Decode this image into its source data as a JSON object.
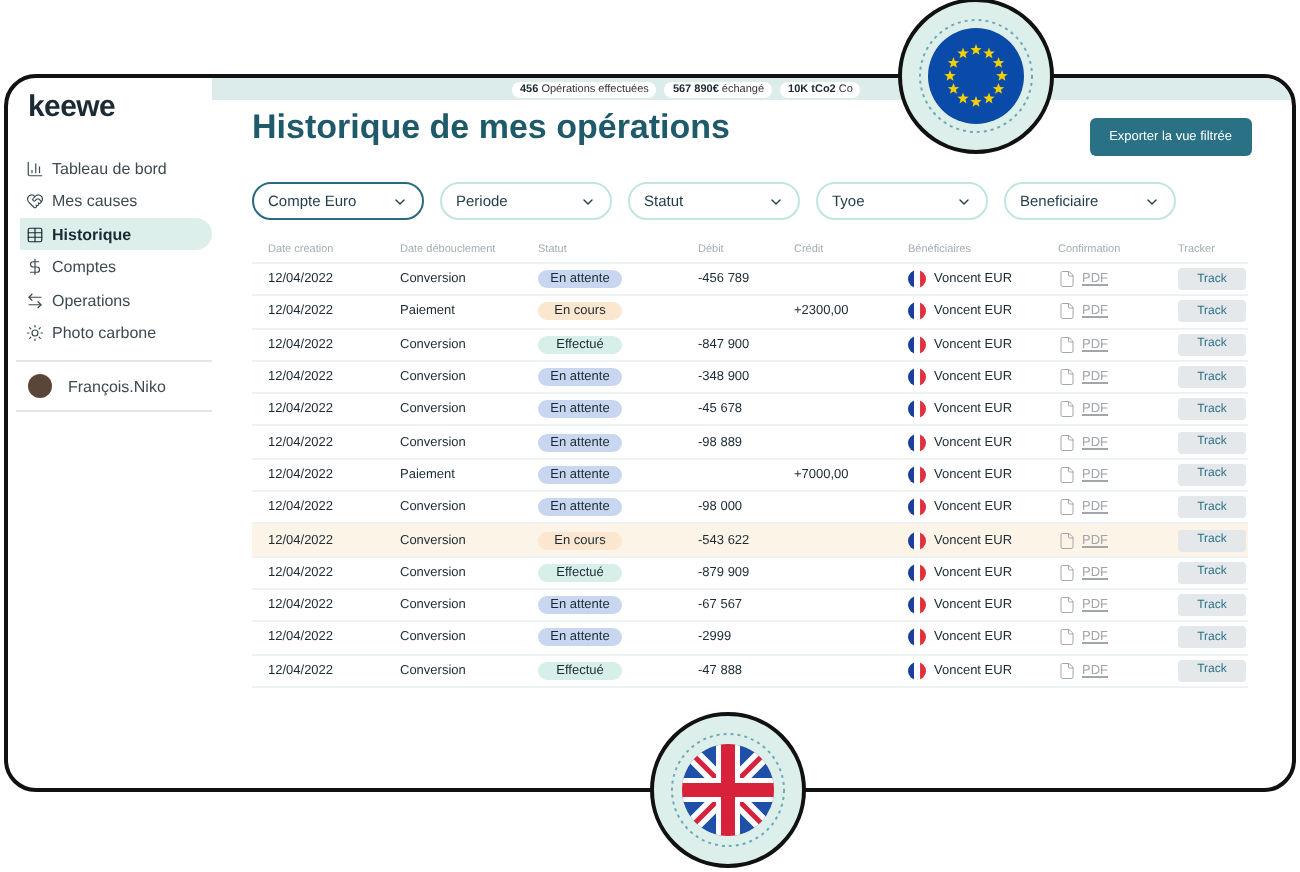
{
  "logo": "keewe",
  "sidebar": {
    "items": [
      {
        "label": "Tableau de bord",
        "selected": false
      },
      {
        "label": "Mes causes",
        "selected": false
      },
      {
        "label": "Historique",
        "selected": true
      },
      {
        "label": "Comptes",
        "selected": false
      },
      {
        "label": "Operations",
        "selected": false
      },
      {
        "label": "Photo carbone",
        "selected": false
      }
    ],
    "user": "François.Niko"
  },
  "stats": [
    {
      "value": "456",
      "label": "Opérations effectuées"
    },
    {
      "value": "567 890€",
      "label": "échangé"
    },
    {
      "value": "10K tCo2",
      "label": "Co"
    }
  ],
  "title": "Historique de mes opérations",
  "export_button": "Exporter la vue filtrée",
  "filters": [
    {
      "label": "Compte Euro",
      "active": true
    },
    {
      "label": "Periode",
      "active": false
    },
    {
      "label": "Statut",
      "active": false
    },
    {
      "label": "Tyoe",
      "active": false
    },
    {
      "label": "Beneficiaire",
      "active": false
    }
  ],
  "table": {
    "columns": [
      "Date creation",
      "Date débouclement",
      "Statut",
      "Débit",
      "Crédit",
      "Bénéficiaires",
      "Confirmation",
      "Tracker"
    ],
    "rows": [
      {
        "date": "12/04/2022",
        "type": "Conversion",
        "status": {
          "label": "En attente",
          "kind": "pending"
        },
        "debit": "-456 789",
        "credit": "",
        "beneficiary": "Voncent EUR",
        "confirmation": "PDF",
        "tracker": "Track",
        "selected": false
      },
      {
        "date": "12/04/2022",
        "type": "Paiement",
        "status": {
          "label": "En cours",
          "kind": "progress"
        },
        "debit": "",
        "credit": "+2300,00",
        "beneficiary": "Voncent EUR",
        "confirmation": "PDF",
        "tracker": "Track",
        "selected": false
      },
      {
        "date": "12/04/2022",
        "type": "Conversion",
        "status": {
          "label": "Effectué",
          "kind": "done"
        },
        "debit": "-847 900",
        "credit": "",
        "beneficiary": "Voncent EUR",
        "confirmation": "PDF",
        "tracker": "Track",
        "selected": false
      },
      {
        "date": "12/04/2022",
        "type": "Conversion",
        "status": {
          "label": "En attente",
          "kind": "pending"
        },
        "debit": "-348 900",
        "credit": "",
        "beneficiary": "Voncent EUR",
        "confirmation": "PDF",
        "tracker": "Track",
        "selected": false
      },
      {
        "date": "12/04/2022",
        "type": "Conversion",
        "status": {
          "label": "En attente",
          "kind": "pending"
        },
        "debit": "-45 678",
        "credit": "",
        "beneficiary": "Voncent EUR",
        "confirmation": "PDF",
        "tracker": "Track",
        "selected": false
      },
      {
        "date": "12/04/2022",
        "type": "Conversion",
        "status": {
          "label": "En attente",
          "kind": "pending"
        },
        "debit": "-98 889",
        "credit": "",
        "beneficiary": "Voncent EUR",
        "confirmation": "PDF",
        "tracker": "Track",
        "selected": false
      },
      {
        "date": "12/04/2022",
        "type": "Paiement",
        "status": {
          "label": "En attente",
          "kind": "pending"
        },
        "debit": "",
        "credit": "+7000,00",
        "beneficiary": "Voncent EUR",
        "confirmation": "PDF",
        "tracker": "Track",
        "selected": false
      },
      {
        "date": "12/04/2022",
        "type": "Conversion",
        "status": {
          "label": "En attente",
          "kind": "pending"
        },
        "debit": "-98 000",
        "credit": "",
        "beneficiary": "Voncent EUR",
        "confirmation": "PDF",
        "tracker": "Track",
        "selected": false
      },
      {
        "date": "12/04/2022",
        "type": "Conversion",
        "status": {
          "label": "En cours",
          "kind": "progress"
        },
        "debit": "-543 622",
        "credit": "",
        "beneficiary": "Voncent EUR",
        "confirmation": "PDF",
        "tracker": "Track",
        "selected": true
      },
      {
        "date": "12/04/2022",
        "type": "Conversion",
        "status": {
          "label": "Effectué",
          "kind": "done"
        },
        "debit": "-879 909",
        "credit": "",
        "beneficiary": "Voncent EUR",
        "confirmation": "PDF",
        "tracker": "Track",
        "selected": false
      },
      {
        "date": "12/04/2022",
        "type": "Conversion",
        "status": {
          "label": "En attente",
          "kind": "pending"
        },
        "debit": "-67 567",
        "credit": "",
        "beneficiary": "Voncent EUR",
        "confirmation": "PDF",
        "tracker": "Track",
        "selected": false
      },
      {
        "date": "12/04/2022",
        "type": "Conversion",
        "status": {
          "label": "En attente",
          "kind": "pending"
        },
        "debit": "-2999",
        "credit": "",
        "beneficiary": "Voncent EUR",
        "confirmation": "PDF",
        "tracker": "Track",
        "selected": false
      },
      {
        "date": "12/04/2022",
        "type": "Conversion",
        "status": {
          "label": "Effectué",
          "kind": "done"
        },
        "debit": "-47 888",
        "credit": "",
        "beneficiary": "Voncent EUR",
        "confirmation": "PDF",
        "tracker": "Track",
        "selected": false
      }
    ]
  }
}
